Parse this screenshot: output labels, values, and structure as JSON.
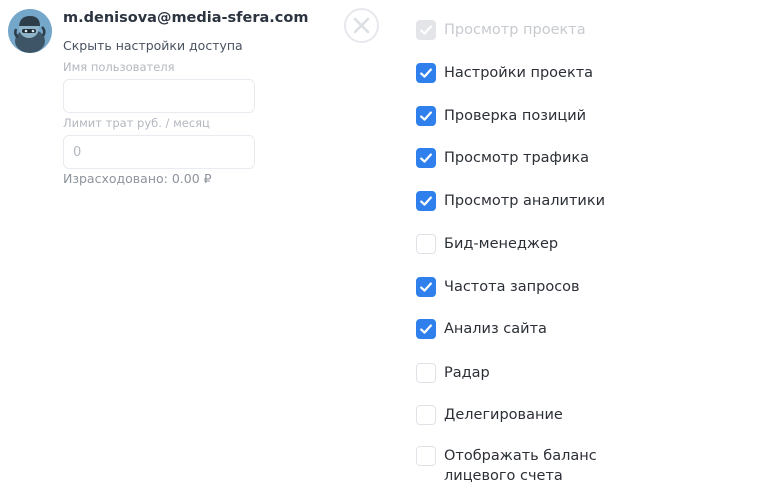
{
  "user": {
    "email": "m.denisova@media-sfera.com",
    "hide_settings_link": "Скрыть настройки доступа"
  },
  "form": {
    "username_label": "Имя пользователя",
    "username_value": "",
    "limit_label": "Лимит трат руб. / месяц",
    "limit_placeholder": "0",
    "spent_text": "Израсходовано: 0.00 ₽"
  },
  "permissions": [
    {
      "label": "Просмотр проекта",
      "checked": true,
      "disabled": true
    },
    {
      "label": "Настройки проекта",
      "checked": true,
      "disabled": false
    },
    {
      "label": "Проверка позиций",
      "checked": true,
      "disabled": false
    },
    {
      "label": "Просмотр трафика",
      "checked": true,
      "disabled": false
    },
    {
      "label": "Просмотр аналитики",
      "checked": true,
      "disabled": false
    },
    {
      "label": "Бид-менеджер",
      "checked": false,
      "disabled": false
    },
    {
      "label": "Частота запросов",
      "checked": true,
      "disabled": false
    },
    {
      "label": "Анализ сайта",
      "checked": true,
      "disabled": false
    },
    {
      "label": "Радар",
      "checked": false,
      "disabled": false
    },
    {
      "label": "Делегирование",
      "checked": false,
      "disabled": false
    },
    {
      "label": "Отображать баланс лицевого счета",
      "checked": false,
      "disabled": false
    }
  ],
  "colors": {
    "accent": "#2f80ed",
    "disabled": "#e3e5e8"
  },
  "icons": {
    "close": "close-icon",
    "check": "checkmark-icon",
    "avatar": "user-avatar"
  }
}
